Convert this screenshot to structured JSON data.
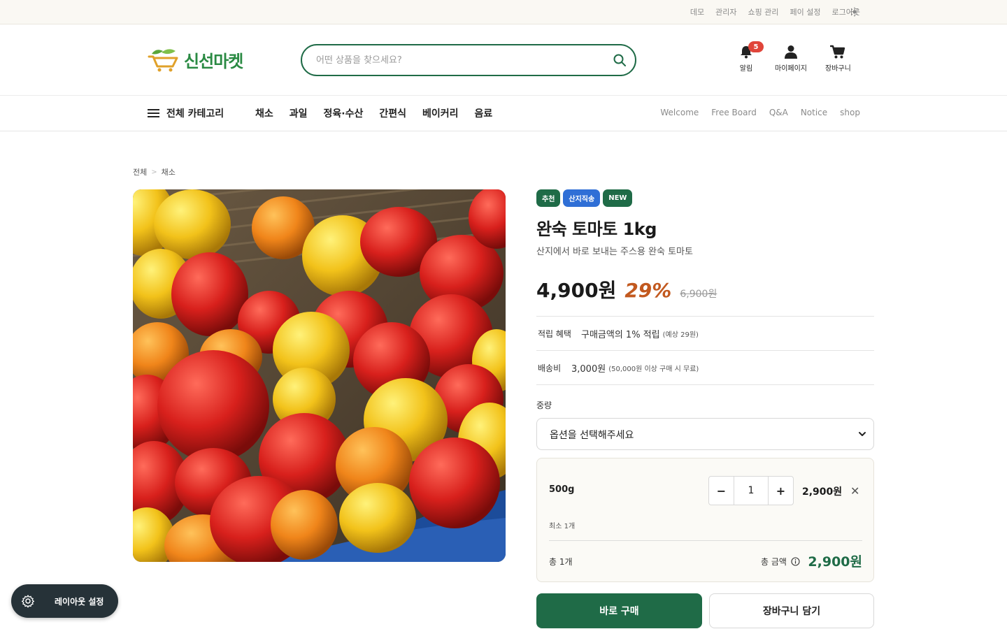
{
  "topbar": {
    "links": [
      "데모",
      "관리자",
      "쇼핑 관리",
      "페이 설정",
      "로그아웃"
    ],
    "theme_icon": "sun-icon"
  },
  "header": {
    "logo_text": "신선마켓",
    "search_placeholder": "어떤 상품을 찾으세요?",
    "icons": {
      "alert_label": "알림",
      "alert_count": "5",
      "mypage_label": "마이페이지",
      "cart_label": "장바구니"
    }
  },
  "nav": {
    "all_categories": "전체 카테고리",
    "categories": [
      "채소",
      "과일",
      "정육·수산",
      "간편식",
      "베이커리",
      "음료"
    ],
    "boards": [
      "Welcome",
      "Free Board",
      "Q&A",
      "Notice",
      "shop"
    ]
  },
  "breadcrumb": {
    "root": "전체",
    "separator": ">",
    "current": "채소"
  },
  "product": {
    "tags": [
      {
        "label": "추천",
        "color": "#1f6b47"
      },
      {
        "label": "산지직송",
        "color": "#2f6fd6"
      },
      {
        "label": "NEW",
        "color": "#1f6b47"
      }
    ],
    "title": "완숙 토마토 1kg",
    "subtitle": "산지에서 바로 보내는 주스용 완숙 토마토",
    "price": "4,900원",
    "discount": "29%",
    "original_price": "6,900원",
    "points_label": "적립 혜택",
    "points_value": "구매금액의 1% 적립",
    "points_note": "(예상 29원)",
    "shipping_label": "배송비",
    "shipping_value": "3,000원",
    "shipping_note": "(50,000원 이상 구매 시 무료)",
    "weight_label": "중량",
    "option_select": "옵션을 선택해주세요",
    "selected_option": {
      "name": "500g",
      "qty": "1",
      "minus": "−",
      "plus": "+",
      "price": "2,900원",
      "remove": "✕",
      "min_note": "최소 1개"
    },
    "total_count": "총 1개",
    "total_label": "총 금액",
    "total_price": "2,900원",
    "buy_now": "바로 구매",
    "add_to_cart": "장바구니 담기"
  },
  "floating": {
    "layout_settings": "레이아웃 설정"
  },
  "colors": {
    "brand_green": "#1f6b47",
    "logo_green": "#2a8a43",
    "discount_orange": "#c2591f",
    "badge_red": "#e0453a",
    "tag_blue": "#2f6fd6"
  }
}
